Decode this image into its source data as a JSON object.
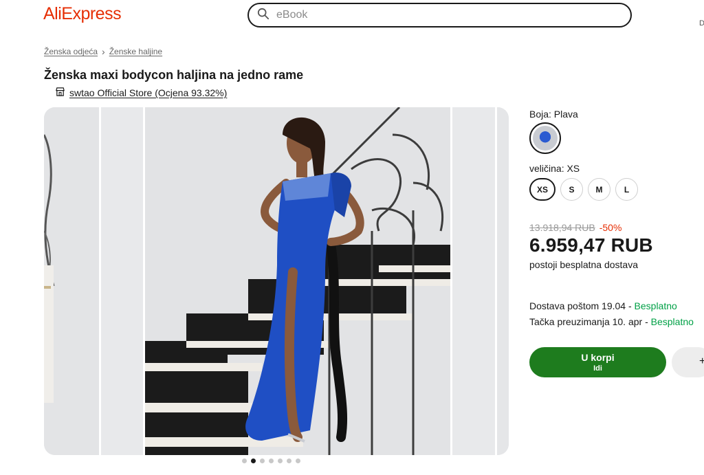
{
  "header": {
    "logo": "AliExpress",
    "search_placeholder": "eBook",
    "edge_mark": "D"
  },
  "breadcrumb": {
    "items": [
      "Ženska odjeća",
      "Ženske haljine"
    ]
  },
  "product": {
    "title": "Ženska maxi bodycon haljina na jedno rame",
    "store": "swtao Official Store (Ocjena 93.32%)"
  },
  "gallery": {
    "dot_count": 7,
    "active_index": 1
  },
  "options": {
    "color_label": "Boja: Plava",
    "size_label": "veličina: XS",
    "sizes": [
      "XS",
      "S",
      "M",
      "L"
    ],
    "selected_size": "XS"
  },
  "pricing": {
    "old_price": "13.918,94 RUB",
    "discount": "-50%",
    "price": "6.959,47 RUB",
    "free_shipping": "postoji besplatna dostava"
  },
  "delivery": {
    "post_text": "Dostava poštom 19.04 - ",
    "post_free": "Besplatno",
    "pickup_text": "Tačka preuzimanja 10. apr - ",
    "pickup_free": "Besplatno"
  },
  "actions": {
    "cart_label": "U korpi",
    "cart_sub": "Idi",
    "second_label": "+"
  },
  "colors": {
    "brand": "#e62e04",
    "cart_green": "#1e7c1e",
    "free_green": "#00a046",
    "dress_blue": "#1f4fc4"
  }
}
